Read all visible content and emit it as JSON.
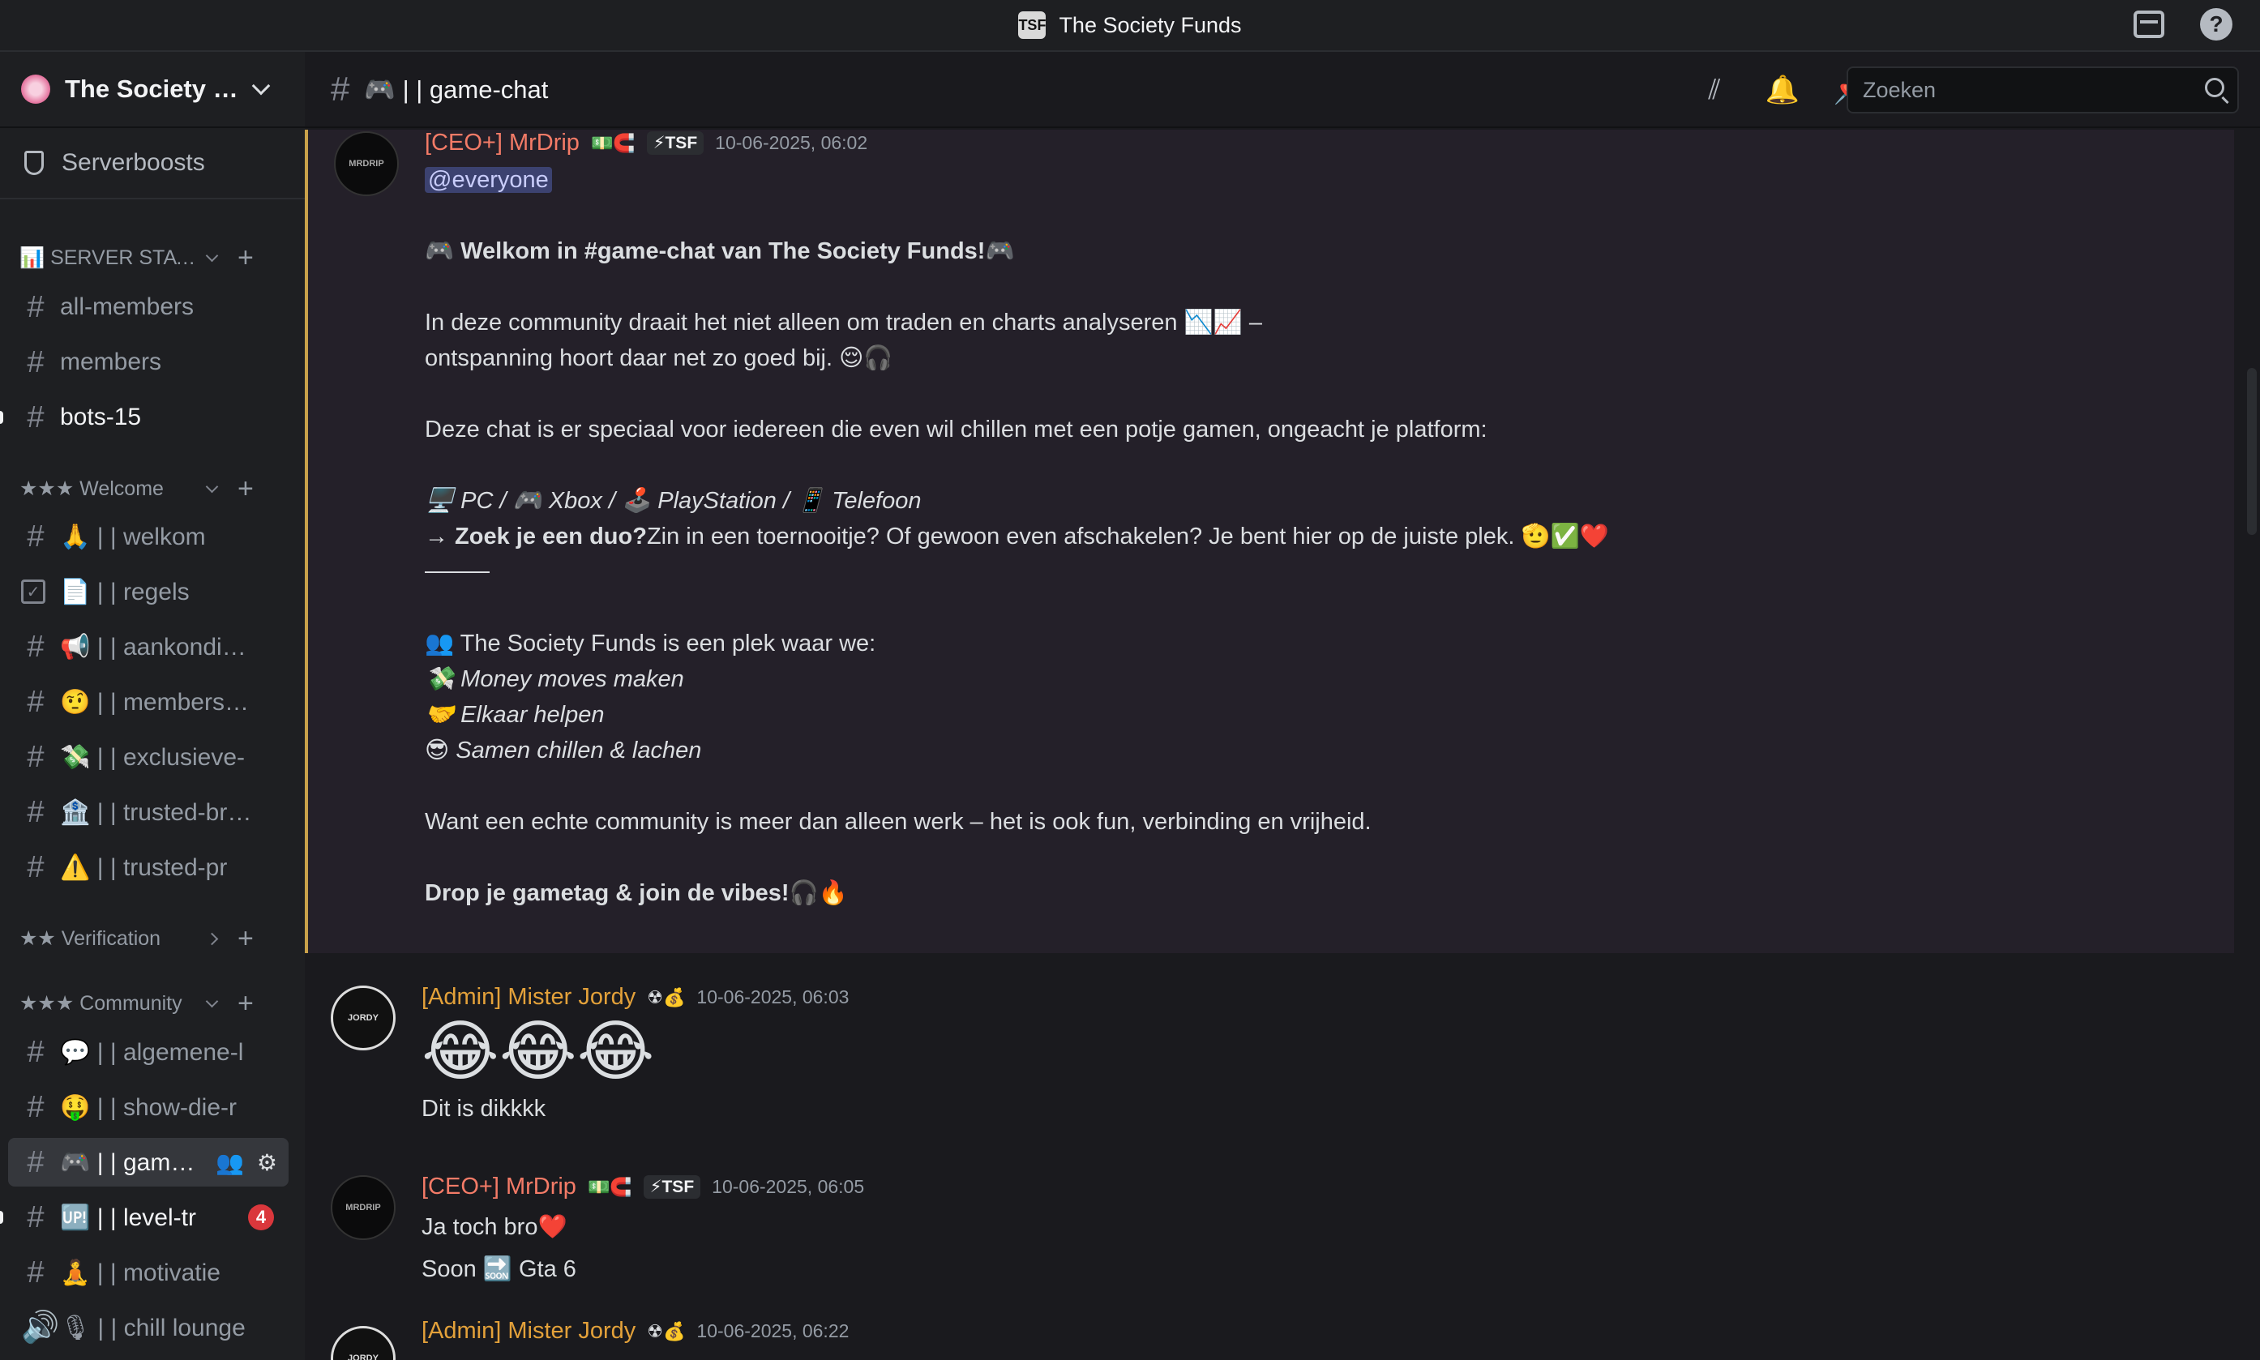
{
  "window": {
    "title": "The Society Funds",
    "logo": "TSF"
  },
  "server": {
    "name": "The Society Funds",
    "boosts_label": "Serverboosts"
  },
  "categories": {
    "stats": "📊 SERVER STATS 📊",
    "welcome": "★★★ Welcome",
    "verification": "★★ Verification",
    "community": "★★★ Community"
  },
  "channels": {
    "all_members": "all-members",
    "members": "members",
    "bots": "bots-15",
    "welkom": "🙏 | | welkom",
    "regels": "📄 | | regels",
    "aankondigingen": "📢 | | aankondigingen",
    "membership": "🤨 | | membership",
    "exclusieve": "💸 | | exclusieve-",
    "trusted_br": "🏦 | | trusted-brokers",
    "trusted_pr": "⚠️ | | trusted-pr",
    "algemene": "💬 | | algemene-l",
    "show_die": "🤑 | | show-die-r",
    "game_chat": "🎮 | | game-chat",
    "level": "🆙 | | level-tr",
    "level_badge": "4",
    "motivatie": "🧘 | | motivatie",
    "chill": "🎙 | | chill lounge"
  },
  "header": {
    "channel_title": "🎮 | | game-chat",
    "search_placeholder": "Zoeken"
  },
  "messages": {
    "m1": {
      "author": "[CEO+] MrDrip",
      "badges": "💵🧲",
      "tag": "⚡TSF",
      "timestamp": "10-06-2025, 06:02",
      "mention": "@everyone",
      "line1": "🎮 Welkom in #game-chat van The Society Funds!🎮",
      "line2": "In deze community draait het niet alleen om traden en charts analyseren 📉📈 –",
      "line3": "ontspanning hoort daar net zo goed bij. 😌🎧",
      "line4": "Deze chat is er speciaal voor iedereen die even wil chillen met een potje gamen, ongeacht je platform:",
      "line5": "🖥️ PC / 🎮 Xbox / 🕹️ PlayStation / 📱 Telefoon",
      "line6_bold": "→ Zoek je een duo?",
      "line6_rest": "Zin in een toernooitje? Of gewoon even afschakelen? Je bent hier op de juiste plek. 🫡✅❤️",
      "line7": "👥 The Society Funds is een plek waar we:",
      "line8": "💸 Money moves maken",
      "line9": "🤝 Elkaar helpen",
      "line10": "😎 Samen chillen & lachen",
      "line11": "Want een echte community is meer dan alleen werk – het is ook fun, verbinding en vrijheid.",
      "line12": "Drop je gametag & join de vibes!🎧🔥"
    },
    "m2": {
      "author": "[Admin] Mister Jordy",
      "badges": "☢💰",
      "timestamp": "10-06-2025, 06:03",
      "emoji_line": "😂😂😂",
      "text": "Dit is dikkkk"
    },
    "m3": {
      "author": "[CEO+] MrDrip",
      "badges": "💵🧲",
      "tag": "⚡TSF",
      "timestamp": "10-06-2025, 06:05",
      "line1": "Ja toch bro❤️",
      "line2": "Soon 🔜 Gta 6"
    },
    "m4": {
      "author": "[Admin] Mister Jordy",
      "badges": "☢💰",
      "timestamp": "10-06-2025, 06:22"
    }
  },
  "avatars": {
    "mrdrip": "MRDRIP",
    "jordy": "JORDY"
  }
}
